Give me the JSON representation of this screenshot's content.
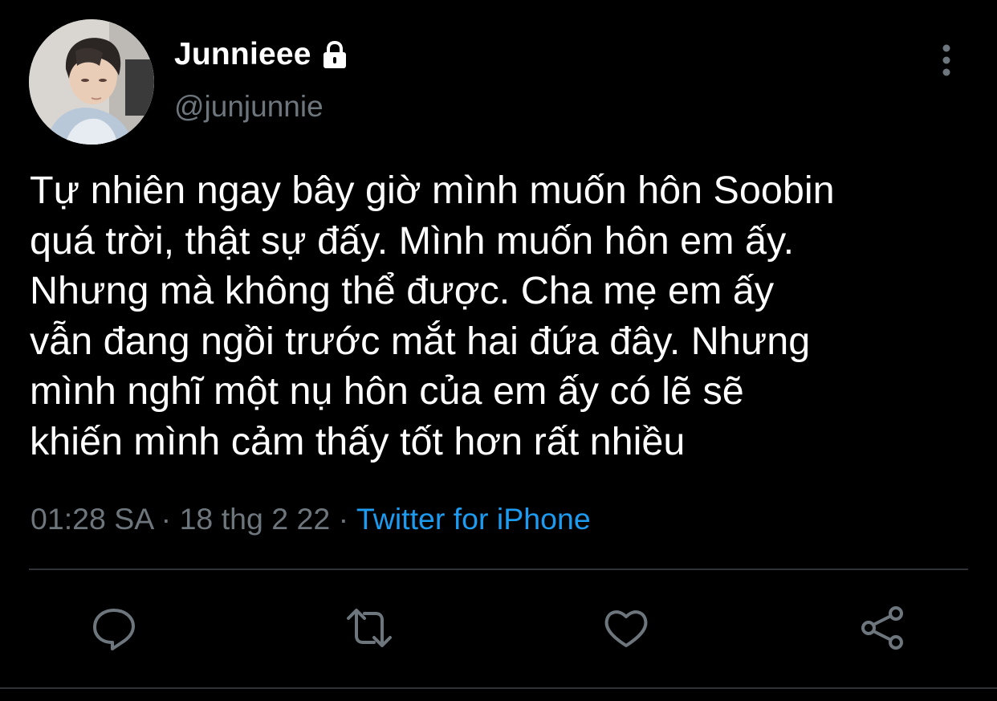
{
  "author": {
    "display_name": "Junnieee",
    "handle": "@junjunnie",
    "protected_icon": "lock-icon",
    "avatar": "profile-photo"
  },
  "tweet": {
    "lines": [
      "Tự nhiên ngay bây giờ mình muốn hôn Soobin",
      "quá trời, thật sự đấy. Mình muốn hôn em ấy.",
      "Nhưng mà không thể được. Cha mẹ em ấy",
      "vẫn đang ngồi trước mắt hai đứa đây. Nhưng",
      "mình nghĩ một nụ hôn của em ấy có lẽ sẽ",
      "khiến mình cảm thấy tốt hơn rất nhiều"
    ],
    "time": "01:28 SA",
    "date": "18 thg 2 22",
    "separator": "·",
    "source": "Twitter for iPhone"
  },
  "actions": [
    {
      "icon": "reply-icon"
    },
    {
      "icon": "retweet-icon"
    },
    {
      "icon": "like-icon"
    },
    {
      "icon": "share-icon"
    }
  ],
  "menu_icon": "more-vertical-icon",
  "colors": {
    "background": "#000000",
    "text": "#ffffff",
    "secondary_text": "#6e767d",
    "link": "#1d9bf0",
    "divider": "#2f3336"
  }
}
